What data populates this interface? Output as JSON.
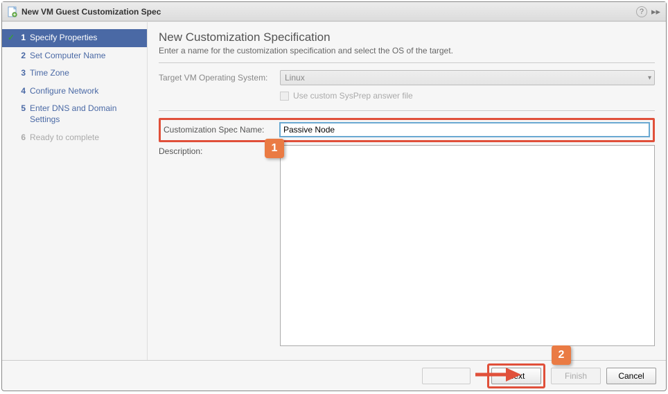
{
  "title": "New VM Guest Customization Spec",
  "steps": [
    {
      "num": "1",
      "label": "Specify Properties",
      "state": "current",
      "checked": true
    },
    {
      "num": "2",
      "label": "Set Computer Name",
      "state": "normal"
    },
    {
      "num": "3",
      "label": "Time Zone",
      "state": "normal"
    },
    {
      "num": "4",
      "label": "Configure Network",
      "state": "normal"
    },
    {
      "num": "5",
      "label": "Enter DNS and Domain Settings",
      "state": "normal"
    },
    {
      "num": "6",
      "label": "Ready to complete",
      "state": "disabled"
    }
  ],
  "heading": "New Customization Specification",
  "subtitle": "Enter a name for the customization specification and select the OS of the target.",
  "form": {
    "target_os_label": "Target VM Operating System:",
    "target_os_value": "Linux",
    "sysprep_label": "Use custom SysPrep answer file",
    "spec_name_label": "Customization Spec Name:",
    "spec_name_value": "Passive Node",
    "description_label": "Description:",
    "description_value": ""
  },
  "buttons": {
    "next": "Next",
    "finish": "Finish",
    "cancel": "Cancel"
  },
  "annotations": {
    "one": "1",
    "two": "2"
  }
}
